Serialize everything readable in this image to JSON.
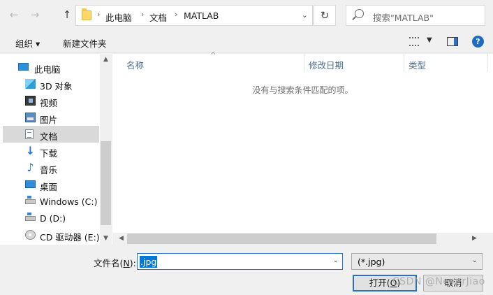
{
  "nav_buttons": {
    "back_icon": "arrow-left-icon",
    "forward_icon": "arrow-right-icon",
    "up_icon": "arrow-up-icon"
  },
  "breadcrumb": [
    "此电脑",
    "文档",
    "MATLAB"
  ],
  "search": {
    "placeholder": "搜索\"MATLAB\""
  },
  "toolbar": {
    "organize": "组织 ▾",
    "new_folder": "新建文件夹"
  },
  "sidebar": {
    "items": [
      {
        "label": "此电脑",
        "icon": "computer-icon"
      },
      {
        "label": "3D 对象",
        "icon": "3d-objects-icon"
      },
      {
        "label": "视频",
        "icon": "video-icon"
      },
      {
        "label": "图片",
        "icon": "pictures-icon"
      },
      {
        "label": "文档",
        "icon": "documents-icon",
        "selected": true
      },
      {
        "label": "下载",
        "icon": "download-icon"
      },
      {
        "label": "音乐",
        "icon": "music-icon"
      },
      {
        "label": "桌面",
        "icon": "desktop-icon"
      },
      {
        "label": "Windows (C:)",
        "icon": "drive-icon"
      },
      {
        "label": "D (D:)",
        "icon": "drive-icon"
      },
      {
        "label": "CD 驱动器 (E:)",
        "icon": "cd-drive-icon"
      }
    ]
  },
  "columns": [
    "名称",
    "修改日期",
    "类型"
  ],
  "empty_message": "没有与搜索条件匹配的项。",
  "filename": {
    "label": "文件名(",
    "hotkey": "N",
    "label_end": "):",
    "value": ".jpg"
  },
  "filetype": {
    "value": "(*.jpg)"
  },
  "buttons": {
    "open_prefix": "打开(",
    "open_hotkey": "O",
    "open_suffix": ")",
    "cancel": "取消"
  },
  "watermark": "CSDN @NeverJiao"
}
